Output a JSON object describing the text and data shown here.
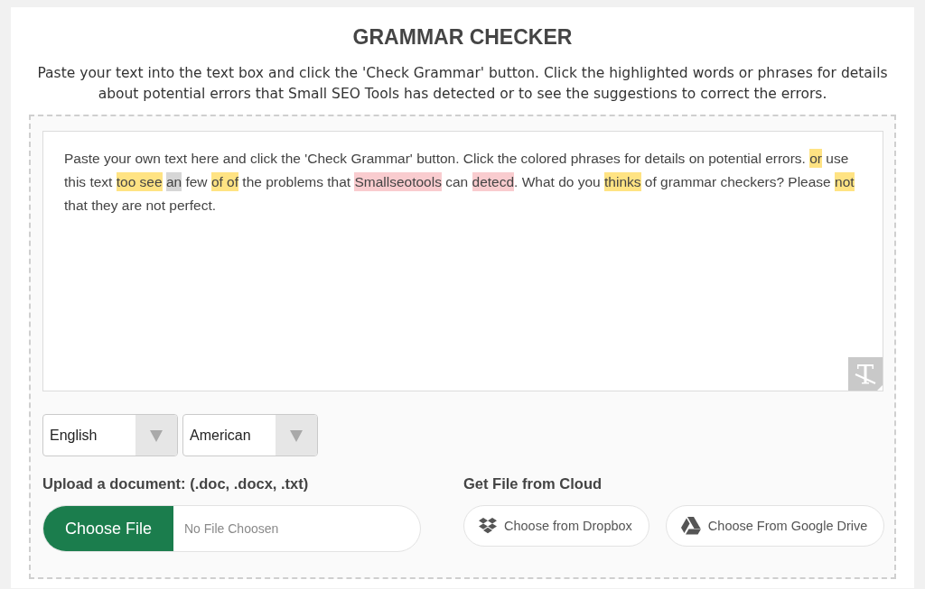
{
  "title": "GRAMMAR CHECKER",
  "description": "Paste your text into the text box and click the 'Check Grammar' button. Click the highlighted words or phrases for details about potential errors that Small SEO Tools has detected or to see the suggestions to correct the errors.",
  "editor": {
    "segments": [
      {
        "text": "Paste your own text here and click the 'Check Grammar' button. Click the colored phrases for details on potential errors. "
      },
      {
        "text": "or",
        "color": "#ffe383"
      },
      {
        "text": " use this text "
      },
      {
        "text": "too see",
        "color": "#ffe383"
      },
      {
        "text": "an",
        "color": "#d6d6d6"
      },
      {
        "text": " few "
      },
      {
        "text": "of of",
        "color": "#ffe383"
      },
      {
        "text": " the problems that "
      },
      {
        "text": "Smallseotools",
        "color": "#f9cccf"
      },
      {
        "text": " can "
      },
      {
        "text": "detecd",
        "color": "#f9cccf"
      },
      {
        "text": ". What do you "
      },
      {
        "text": "thinks",
        "color": "#ffe383"
      },
      {
        "text": " of grammar checkers? Please "
      },
      {
        "text": "not",
        "color": "#ffe383"
      },
      {
        "text": " that they are not perfect."
      }
    ]
  },
  "dropdowns": [
    {
      "value": "English"
    },
    {
      "value": "American"
    }
  ],
  "upload": {
    "label": "Upload a document: (.doc, .docx, .txt)",
    "button": "Choose File",
    "file_status": "No File Choosen"
  },
  "cloud": {
    "label": "Get File from Cloud",
    "buttons": [
      {
        "kind": "dropbox",
        "label": "Choose from Dropbox"
      },
      {
        "kind": "google_drive",
        "label": "Choose From Google Drive"
      }
    ]
  }
}
